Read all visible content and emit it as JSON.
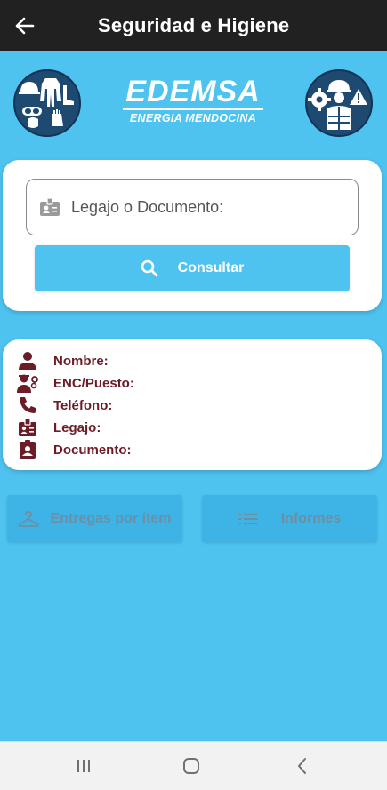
{
  "appbar": {
    "title": "Seguridad e Higiene",
    "back_icon": "arrow-left-icon"
  },
  "brand": {
    "name": "EDEMSA",
    "subtitle": "ENERGIA MENDOCINA"
  },
  "search": {
    "placeholder": "Legajo o Documento:",
    "value": "",
    "icon": "id-badge-icon",
    "button_label": "Consultar",
    "button_icon": "search-icon"
  },
  "info": {
    "rows": [
      {
        "label": "Nombre:",
        "icon": "person-icon"
      },
      {
        "label": "ENC/Puesto:",
        "icon": "person-gear-icon"
      },
      {
        "label": "Teléfono:",
        "icon": "phone-icon"
      },
      {
        "label": "Legajo:",
        "icon": "id-badge-icon"
      },
      {
        "label": "Documento:",
        "icon": "contact-card-icon"
      }
    ]
  },
  "actions": {
    "entregas_label": "Entregas por ítem",
    "entregas_icon": "hanger-icon",
    "informes_label": "Informes",
    "informes_icon": "list-icon"
  },
  "navbar": {
    "recents_icon": "recents-icon",
    "home_icon": "home-icon",
    "back_icon": "chevron-left-icon"
  },
  "colors": {
    "background": "#4fc3f0",
    "appbar": "#212121",
    "card": "#ffffff",
    "label_text": "#6b1c26",
    "badge": "#1e4a72"
  }
}
